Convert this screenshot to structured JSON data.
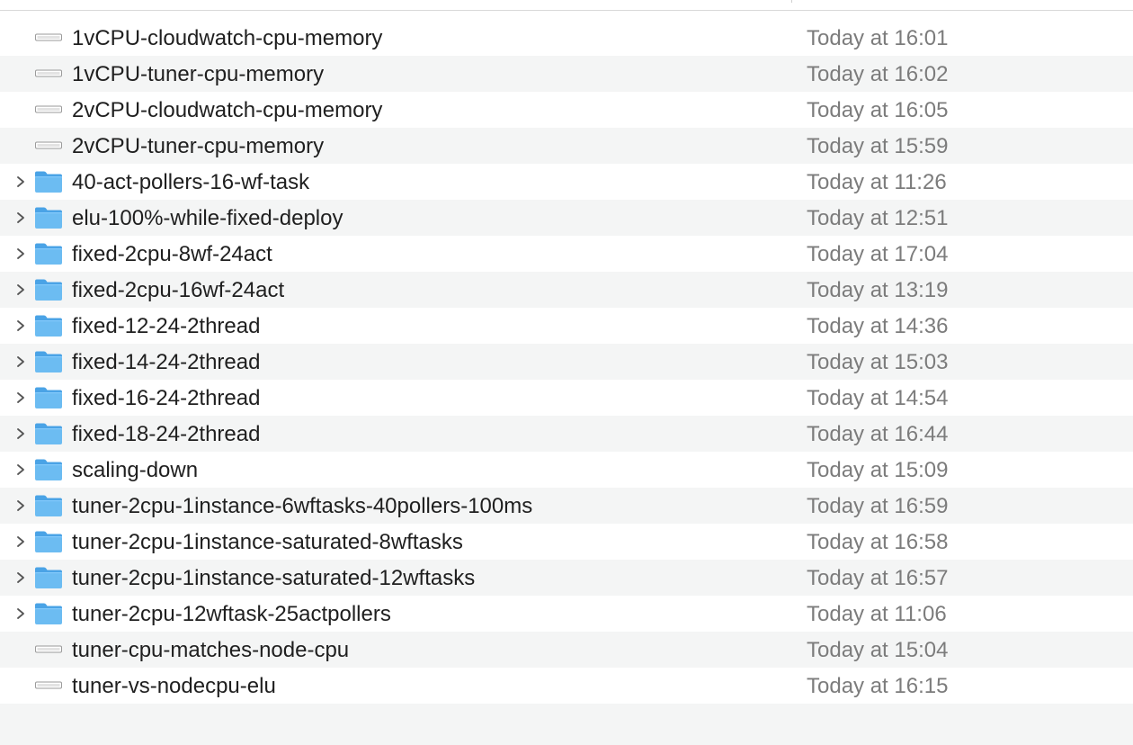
{
  "files": [
    {
      "name": "1vCPU-cloudwatch-cpu-memory",
      "date": "Today at 16:01",
      "kind": "file",
      "icon": "document-icon"
    },
    {
      "name": "1vCPU-tuner-cpu-memory",
      "date": "Today at 16:02",
      "kind": "file",
      "icon": "document-icon"
    },
    {
      "name": "2vCPU-cloudwatch-cpu-memory",
      "date": "Today at 16:05",
      "kind": "file",
      "icon": "document-icon"
    },
    {
      "name": "2vCPU-tuner-cpu-memory",
      "date": "Today at 15:59",
      "kind": "file",
      "icon": "document-icon"
    },
    {
      "name": "40-act-pollers-16-wf-task",
      "date": "Today at 11:26",
      "kind": "folder",
      "icon": "folder-icon"
    },
    {
      "name": "elu-100%-while-fixed-deploy",
      "date": "Today at 12:51",
      "kind": "folder",
      "icon": "folder-icon"
    },
    {
      "name": "fixed-2cpu-8wf-24act",
      "date": "Today at 17:04",
      "kind": "folder",
      "icon": "folder-icon"
    },
    {
      "name": "fixed-2cpu-16wf-24act",
      "date": "Today at 13:19",
      "kind": "folder",
      "icon": "folder-icon"
    },
    {
      "name": "fixed-12-24-2thread",
      "date": "Today at 14:36",
      "kind": "folder",
      "icon": "folder-icon"
    },
    {
      "name": "fixed-14-24-2thread",
      "date": "Today at 15:03",
      "kind": "folder",
      "icon": "folder-icon"
    },
    {
      "name": "fixed-16-24-2thread",
      "date": "Today at 14:54",
      "kind": "folder",
      "icon": "folder-icon"
    },
    {
      "name": "fixed-18-24-2thread",
      "date": "Today at 16:44",
      "kind": "folder",
      "icon": "folder-icon"
    },
    {
      "name": "scaling-down",
      "date": "Today at 15:09",
      "kind": "folder",
      "icon": "folder-icon"
    },
    {
      "name": "tuner-2cpu-1instance-6wftasks-40pollers-100ms",
      "date": "Today at 16:59",
      "kind": "folder",
      "icon": "folder-icon"
    },
    {
      "name": "tuner-2cpu-1instance-saturated-8wftasks",
      "date": "Today at 16:58",
      "kind": "folder",
      "icon": "folder-icon"
    },
    {
      "name": "tuner-2cpu-1instance-saturated-12wftasks",
      "date": "Today at 16:57",
      "kind": "folder",
      "icon": "folder-icon"
    },
    {
      "name": "tuner-2cpu-12wftask-25actpollers",
      "date": "Today at 11:06",
      "kind": "folder",
      "icon": "folder-icon"
    },
    {
      "name": "tuner-cpu-matches-node-cpu",
      "date": "Today at 15:04",
      "kind": "file",
      "icon": "document-icon"
    },
    {
      "name": "tuner-vs-nodecpu-elu",
      "date": "Today at 16:15",
      "kind": "file",
      "icon": "document-icon"
    }
  ],
  "colors": {
    "folder_front": "#6cbcf2",
    "folder_back": "#4aa3e6",
    "alt_row": "#f4f5f5",
    "date_text": "#7c7c7c",
    "name_text": "#1f1f1f"
  }
}
